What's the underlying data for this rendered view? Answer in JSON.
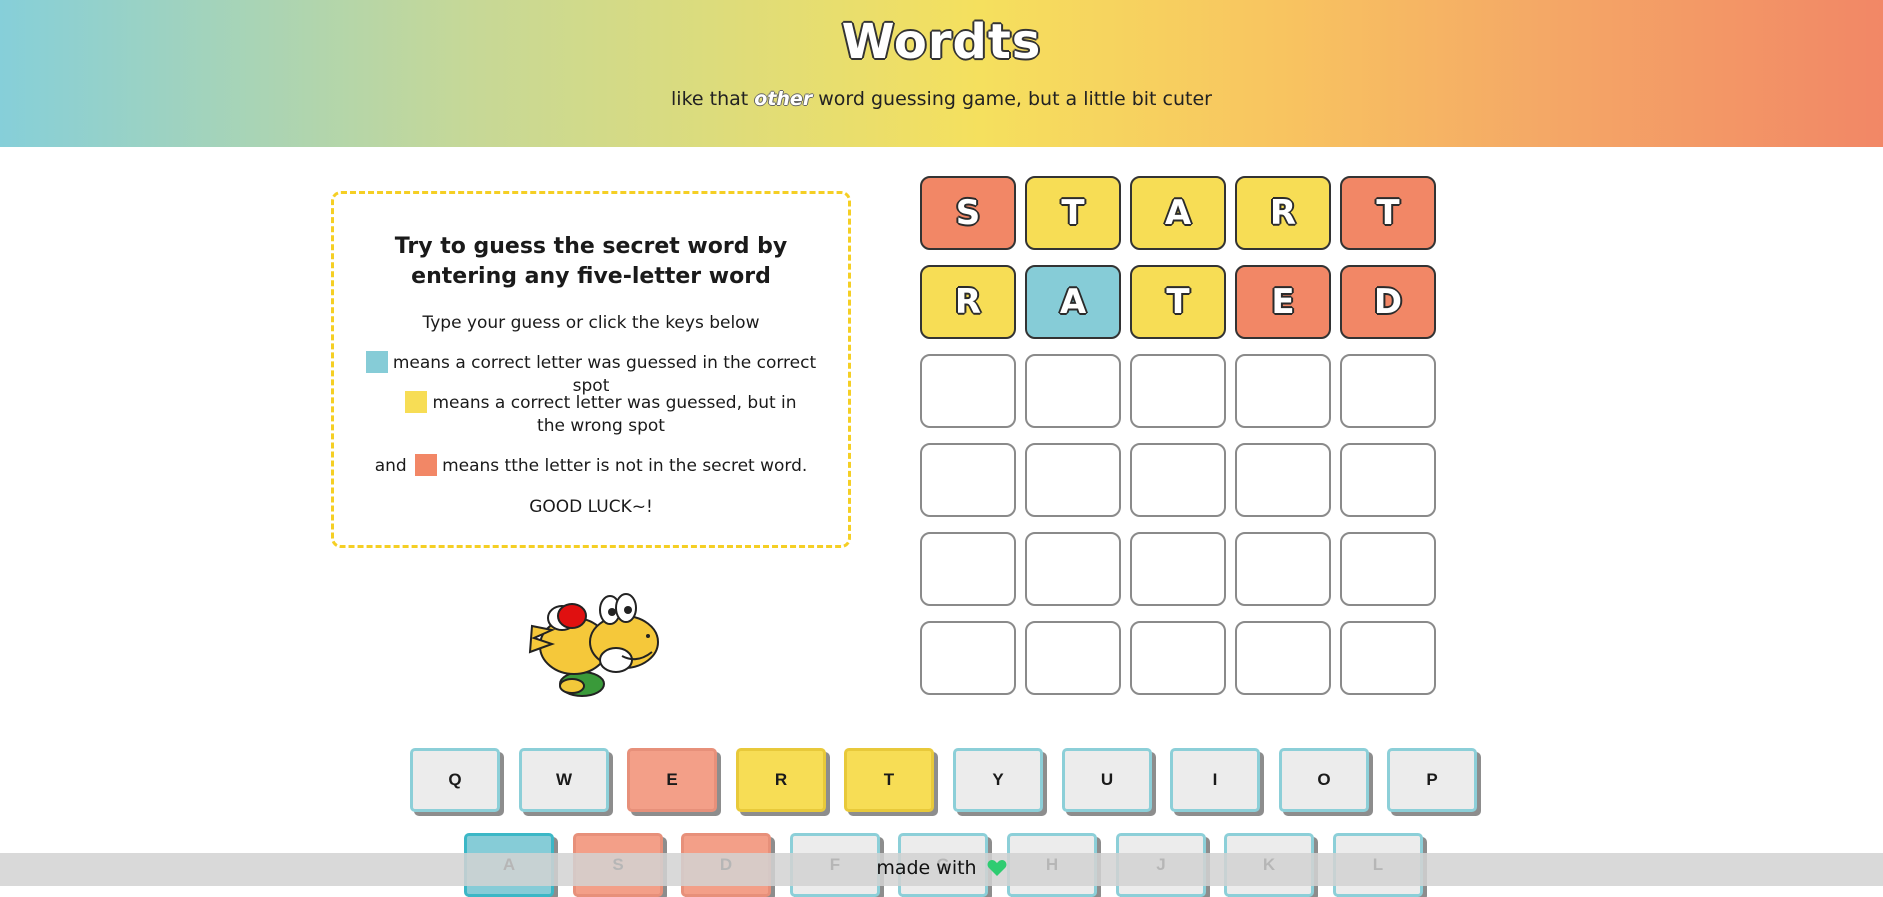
{
  "header": {
    "title": "Wordts",
    "subtitle_before": "like that ",
    "subtitle_em": "other",
    "subtitle_after": " word guessing game, but a little bit cuter"
  },
  "instructions": {
    "heading": "Try to guess the secret word by entering any five-letter word",
    "line1": "Type your guess or click the keys below",
    "line2": "means a correct letter was guessed in the correct spot",
    "line3": "means a correct letter was guessed, but in the wrong spot",
    "line4_prefix": "and",
    "line4": "means tthe letter is not in the secret word.",
    "line5": "GOOD LUCK~!"
  },
  "colors": {
    "correct": "#86ccd7",
    "present": "#f7dd55",
    "absent": "#f28766"
  },
  "board": {
    "rows": [
      [
        {
          "letter": "S",
          "state": "absent"
        },
        {
          "letter": "T",
          "state": "present"
        },
        {
          "letter": "A",
          "state": "present"
        },
        {
          "letter": "R",
          "state": "present"
        },
        {
          "letter": "T",
          "state": "absent"
        }
      ],
      [
        {
          "letter": "R",
          "state": "present"
        },
        {
          "letter": "A",
          "state": "correct"
        },
        {
          "letter": "T",
          "state": "present"
        },
        {
          "letter": "E",
          "state": "absent"
        },
        {
          "letter": "D",
          "state": "absent"
        }
      ],
      [
        {
          "letter": "",
          "state": "empty"
        },
        {
          "letter": "",
          "state": "empty"
        },
        {
          "letter": "",
          "state": "empty"
        },
        {
          "letter": "",
          "state": "empty"
        },
        {
          "letter": "",
          "state": "empty"
        }
      ],
      [
        {
          "letter": "",
          "state": "empty"
        },
        {
          "letter": "",
          "state": "empty"
        },
        {
          "letter": "",
          "state": "empty"
        },
        {
          "letter": "",
          "state": "empty"
        },
        {
          "letter": "",
          "state": "empty"
        }
      ],
      [
        {
          "letter": "",
          "state": "empty"
        },
        {
          "letter": "",
          "state": "empty"
        },
        {
          "letter": "",
          "state": "empty"
        },
        {
          "letter": "",
          "state": "empty"
        },
        {
          "letter": "",
          "state": "empty"
        }
      ],
      [
        {
          "letter": "",
          "state": "empty"
        },
        {
          "letter": "",
          "state": "empty"
        },
        {
          "letter": "",
          "state": "empty"
        },
        {
          "letter": "",
          "state": "empty"
        },
        {
          "letter": "",
          "state": "empty"
        }
      ]
    ]
  },
  "keyboard": {
    "rows": [
      [
        {
          "key": "Q",
          "state": "unused"
        },
        {
          "key": "W",
          "state": "unused"
        },
        {
          "key": "E",
          "state": "absent"
        },
        {
          "key": "R",
          "state": "present"
        },
        {
          "key": "T",
          "state": "present"
        },
        {
          "key": "Y",
          "state": "unused"
        },
        {
          "key": "U",
          "state": "unused"
        },
        {
          "key": "I",
          "state": "unused"
        },
        {
          "key": "O",
          "state": "unused"
        },
        {
          "key": "P",
          "state": "unused"
        }
      ],
      [
        {
          "key": "A",
          "state": "correct"
        },
        {
          "key": "S",
          "state": "absent"
        },
        {
          "key": "D",
          "state": "absent"
        },
        {
          "key": "F",
          "state": "unused"
        },
        {
          "key": "G",
          "state": "unused"
        },
        {
          "key": "H",
          "state": "unused"
        },
        {
          "key": "J",
          "state": "unused"
        },
        {
          "key": "K",
          "state": "unused"
        },
        {
          "key": "L",
          "state": "unused"
        }
      ]
    ]
  },
  "mascot": {
    "icon": "yoshi-mascot-icon"
  },
  "footer": {
    "text": "made with",
    "icon": "heart-icon",
    "heart_color": "#2ecc71"
  }
}
